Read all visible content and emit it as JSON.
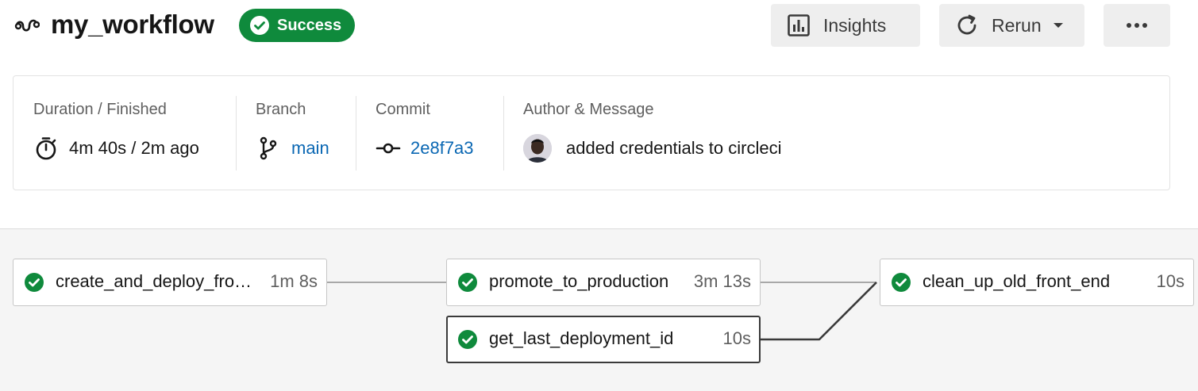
{
  "header": {
    "workflow_icon": "workflow-icon",
    "title": "my_workflow",
    "status": {
      "label": "Success",
      "color": "#0f8a3c",
      "icon": "check-circle-icon"
    },
    "buttons": {
      "insights": {
        "label": "Insights",
        "icon": "bar-chart-icon"
      },
      "rerun": {
        "label": "Rerun",
        "icon": "refresh-icon"
      },
      "more": {
        "icon": "more-dots-icon"
      }
    }
  },
  "info": {
    "duration": {
      "label": "Duration / Finished",
      "value": "4m 40s / 2m ago",
      "icon": "stopwatch-icon"
    },
    "branch": {
      "label": "Branch",
      "value": "main",
      "icon": "branch-icon"
    },
    "commit": {
      "label": "Commit",
      "value": "2e8f7a3",
      "icon": "commit-icon"
    },
    "author": {
      "label": "Author & Message",
      "message": "added credentials to circleci",
      "avatar": "avatar"
    }
  },
  "jobs": [
    {
      "name": "create_and_deploy_fro…",
      "duration": "1m 8s",
      "status": "success"
    },
    {
      "name": "promote_to_production",
      "duration": "3m 13s",
      "status": "success"
    },
    {
      "name": "get_last_deployment_id",
      "duration": "10s",
      "status": "success",
      "selected": true
    },
    {
      "name": "clean_up_old_front_end",
      "duration": "10s",
      "status": "success"
    }
  ],
  "colors": {
    "success": "#0f8a3c",
    "link": "#0a67b3"
  }
}
